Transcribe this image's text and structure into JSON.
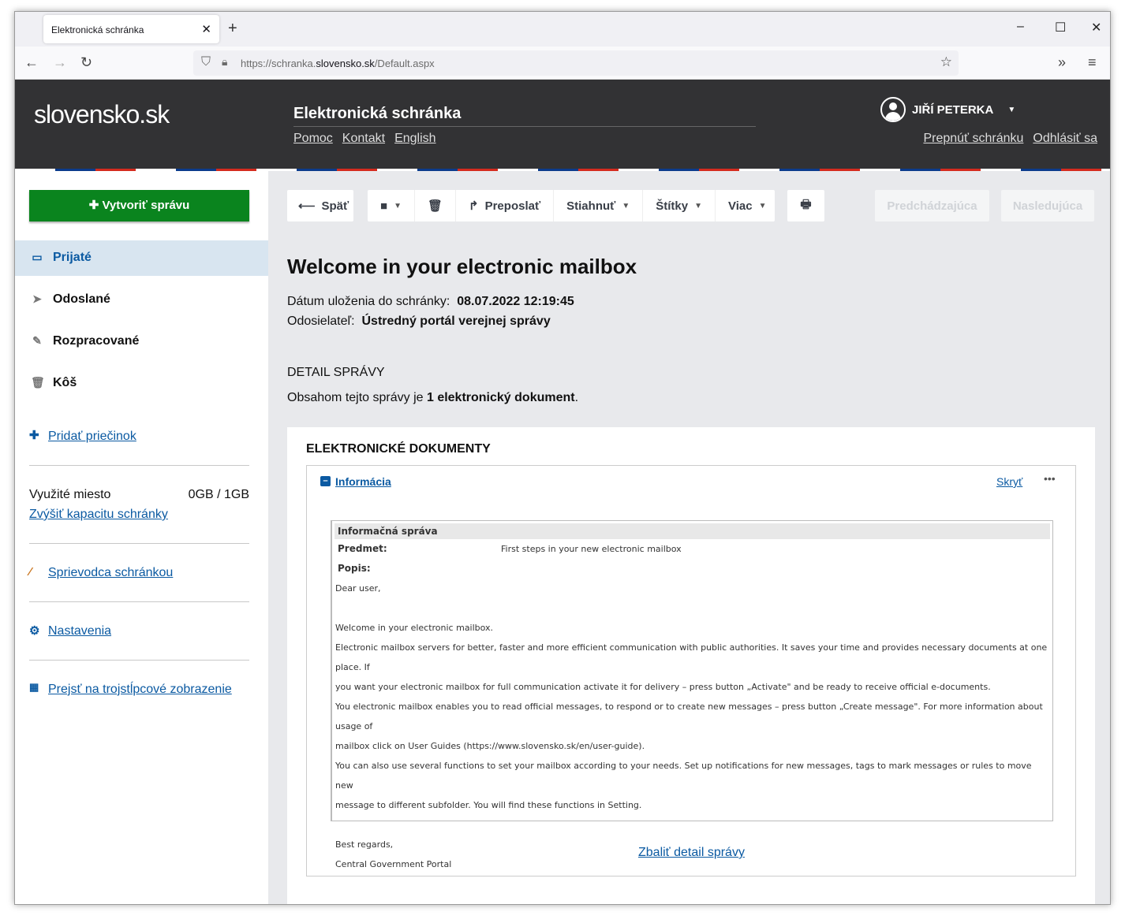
{
  "browser": {
    "tab_title": "Elektronická schránka",
    "url_prefix": "https://schranka.",
    "url_domain": "slovensko.sk",
    "url_path": "/Default.aspx"
  },
  "header": {
    "logo": "slovensko.sk",
    "title": "Elektronická schránka",
    "links": [
      "Pomoc",
      "Kontakt",
      "English"
    ],
    "user": "JIŘÍ PETERKA",
    "user_links": [
      "Prepnúť schránku",
      "Odhlásiť sa"
    ]
  },
  "sidebar": {
    "create": "Vytvoriť správu",
    "items": [
      {
        "label": "Prijaté",
        "icon": "inbox-icon"
      },
      {
        "label": "Odoslané",
        "icon": "paper-plane-icon"
      },
      {
        "label": "Rozpracované",
        "icon": "pencil-icon"
      },
      {
        "label": "Kôš",
        "icon": "trash-icon"
      }
    ],
    "add_folder": "Pridať priečinok",
    "storage_label": "Využité miesto",
    "storage_value": "0GB / 1GB",
    "increase": "Zvýšiť kapacitu schránky",
    "guide": "Sprievodca schránkou",
    "settings": "Nastavenia",
    "three_col": "Prejsť na trojstĺpcové zobrazenie"
  },
  "toolbar": {
    "back": "Späť",
    "forward": "Preposlať",
    "download": "Stiahnuť",
    "tags": "Štítky",
    "more": "Viac",
    "prev": "Predchádzajúca",
    "next": "Nasledujúca"
  },
  "message": {
    "title": "Welcome in your electronic mailbox",
    "date_label": "Dátum uloženia do schránky:",
    "date": "08.07.2022 12:19:45",
    "sender_label": "Odosielateľ:",
    "sender": "Ústredný portál verejnej správy",
    "detail_heading": "DETAIL SPRÁVY",
    "detail_pre": "Obsahom tejto správy je ",
    "detail_bold": "1 elektronický dokument",
    "detail_post": ".",
    "docs_heading": "ELEKTRONICKÉ DOKUMENTY",
    "doc_name": "Informácia",
    "hide": "Skryť",
    "collapse": "Zbaliť detail správy",
    "info": {
      "heading": "Informačná správa",
      "subject_label": "Predmet:",
      "subject": "First steps in your new electronic mailbox",
      "desc_label": "Popis:",
      "lines": [
        "Dear user,",
        "",
        "Welcome in your electronic mailbox.",
        "Electronic mailbox servers for better, faster and more efficient communication with public authorities. It saves your time and provides necessary documents at one place. If",
        "you want your electronic mailbox for full communication activate it for delivery – press button „Activate\" and be ready to receive official e-documents.",
        "You electronic mailbox enables you to read official messages, to respond or to create new messages – press button „Create message\". For more information about usage of",
        "mailbox click on User Guides (https://www.slovensko.sk/en/user-guide).",
        "You can also use several functions to set your mailbox according to your needs. Set up notifications for new messages, tags to mark messages or rules to move new",
        "message to different subfolder. You will find these functions in Setting.",
        "",
        "Best regards,",
        "Central Government Portal"
      ]
    }
  }
}
